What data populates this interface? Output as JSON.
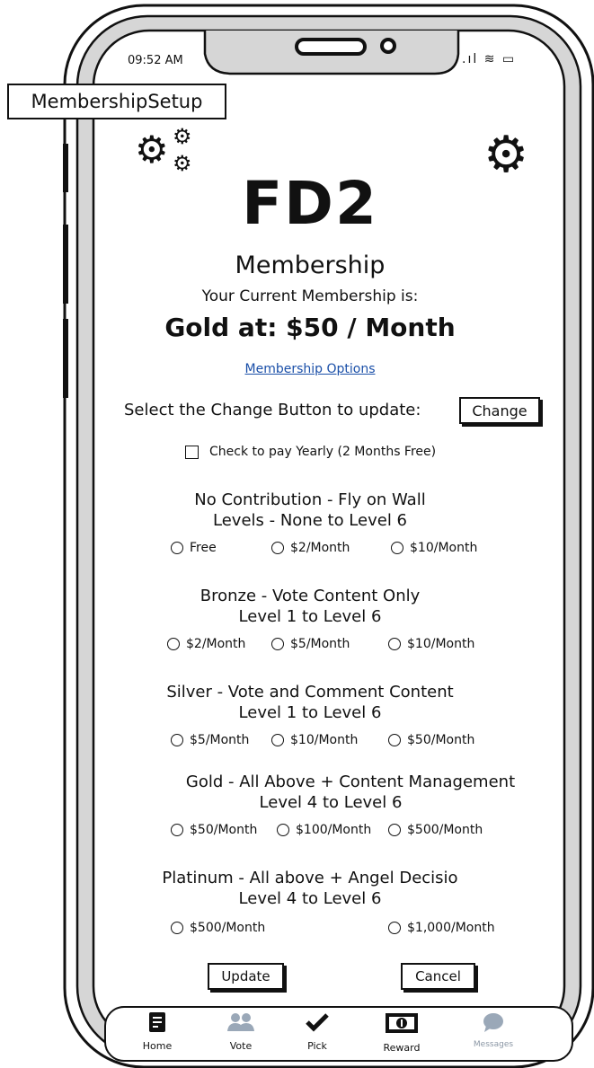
{
  "status_bar": {
    "time": "09:52 AM",
    "signal_icon": "signal-icon",
    "wifi_icon": "wifi-icon",
    "battery_icon": "battery-icon"
  },
  "screen_label": "MembershipSetup",
  "header": {
    "admin_icon": "gears-icon",
    "settings_icon": "gear-icon"
  },
  "page": {
    "title": "FD2",
    "subtitle": "Membership",
    "current_label": "Your Current Membership is:",
    "current_value": "Gold at:  $50 / Month",
    "options_link": "Membership Options",
    "change_prompt": "Select the Change Button to update:",
    "change_button": "Change",
    "yearly_label": "Check to pay Yearly (2 Months Free)"
  },
  "tiers": [
    {
      "title_line1": "No Contribution - Fly on Wall",
      "title_line2": "Levels - None to Level 6",
      "options": [
        "Free",
        "$2/Month",
        "$10/Month"
      ]
    },
    {
      "title_line1": "Bronze - Vote Content Only",
      "title_line2": "Level 1 to Level 6",
      "options": [
        "$2/Month",
        "$5/Month",
        "$10/Month"
      ]
    },
    {
      "title_line1": "Silver - Vote and Comment Content",
      "title_line2": "Level 1 to Level 6",
      "options": [
        "$5/Month",
        "$10/Month",
        "$50/Month"
      ]
    },
    {
      "title_line1": "Gold - All Above + Content Management",
      "title_line2": "Level 4 to Level 6",
      "options": [
        "$50/Month",
        "$100/Month",
        "$500/Month"
      ]
    },
    {
      "title_line1": "Platinum - All above + Angel Decisio",
      "title_line2": "Level 4 to Level 6",
      "options": [
        "$500/Month",
        "$1,000/Month"
      ]
    }
  ],
  "actions": {
    "update": "Update",
    "cancel": "Cancel"
  },
  "tabbar": {
    "items": [
      {
        "label": "Home",
        "icon": "document-icon",
        "color": "#111111"
      },
      {
        "label": "Vote",
        "icon": "people-icon",
        "color": "#9aa8b8"
      },
      {
        "label": "Pick",
        "icon": "checkmark-icon",
        "color": "#111111"
      },
      {
        "label": "Reward",
        "icon": "banknote-icon",
        "color": "#111111"
      },
      {
        "label": "Messages",
        "icon": "chat-bubble-icon",
        "color": "#9aa8b8"
      }
    ]
  },
  "colors": {
    "link": "#1a4fa8",
    "frame": "#111111",
    "bezel": "#d6d6d6"
  }
}
